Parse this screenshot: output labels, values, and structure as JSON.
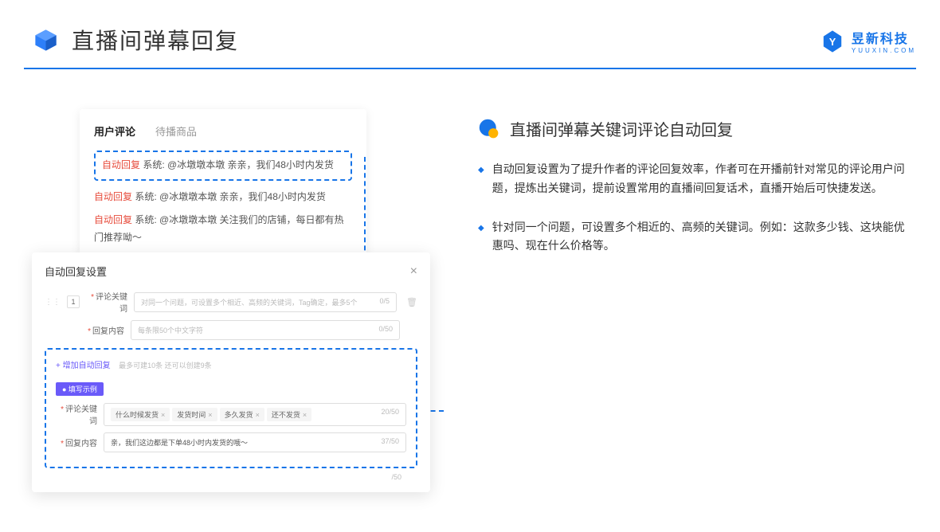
{
  "header": {
    "title": "直播间弹幕回复"
  },
  "brand": {
    "cn": "昱新科技",
    "en": "YUUXIN.COM"
  },
  "commentPanel": {
    "tab1": "用户评论",
    "tab2": "待播商品",
    "highlighted": {
      "tag": "自动回复",
      "text": " 系统: @冰墩墩本墩 亲亲，我们48小时内发货"
    },
    "c2": {
      "tag": "自动回复",
      "text": " 系统: @冰墩墩本墩 亲亲，我们48小时内发货"
    },
    "c3": {
      "tag": "自动回复",
      "text": " 系统: @冰墩墩本墩 关注我们的店铺，每日都有热门推荐呦～"
    }
  },
  "settings": {
    "title": "自动回复设置",
    "rowNum": "1",
    "keywordLabel": "评论关键词",
    "keywordPlaceholder": "对同一个问题，可设置多个相近、高频的关键词，Tag确定，最多5个",
    "keywordCounter": "0/5",
    "contentLabel": "回复内容",
    "contentPlaceholder": "每条限50个中文字符",
    "contentCounter": "0/50",
    "addLink": "+ 增加自动回复",
    "addHint": "最多可建10条 还可以创建9条",
    "exampleBadge": "● 填写示例",
    "exKeywordLabel": "评论关键词",
    "exTags": [
      "什么时候发货",
      "发货时间",
      "多久发货",
      "还不发货"
    ],
    "exKeywordCounter": "20/50",
    "exContentLabel": "回复内容",
    "exContent": "亲，我们这边都是下单48小时内发货的哦～",
    "exContentCounter": "37/50",
    "bottomCounter": "/50"
  },
  "right": {
    "sectionTitle": "直播间弹幕关键词评论自动回复",
    "b1": "自动回复设置为了提升作者的评论回复效率，作者可在开播前针对常见的评论用户问题，提炼出关键词，提前设置常用的直播间回复话术，直播开始后可快捷发送。",
    "b2": "针对同一个问题，可设置多个相近的、高频的关键词。例如：这款多少钱、这块能优惠吗、现在什么价格等。"
  }
}
